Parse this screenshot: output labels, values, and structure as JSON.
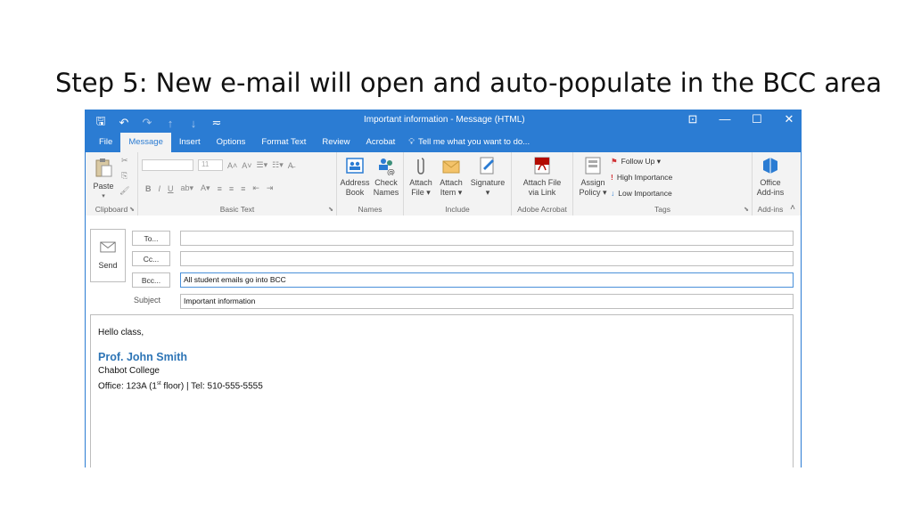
{
  "slide": {
    "title": "Step 5: New e-mail will open and auto-populate in the BCC area"
  },
  "window": {
    "title": "Important information - Message (HTML)",
    "qat": [
      "save-icon",
      "undo-icon",
      "redo-icon",
      "up-icon",
      "down-icon",
      "customize-icon"
    ],
    "controls": [
      "ribbon-display-icon",
      "minimize-icon",
      "maximize-icon",
      "close-icon"
    ]
  },
  "tabs": [
    "File",
    "Message",
    "Insert",
    "Options",
    "Format Text",
    "Review",
    "Acrobat"
  ],
  "tell_me": "Tell me what you want to do...",
  "ribbon": {
    "clipboard": {
      "paste": "Paste",
      "label": "Clipboard"
    },
    "basic_text": {
      "font_size": "11",
      "label": "Basic Text"
    },
    "names": {
      "address_book_1": "Address",
      "address_book_2": "Book",
      "check_names_1": "Check",
      "check_names_2": "Names",
      "label": "Names"
    },
    "include": {
      "attach_file_1": "Attach",
      "attach_file_2": "File ▾",
      "attach_item_1": "Attach",
      "attach_item_2": "Item ▾",
      "signature": "Signature",
      "signature_2": "▾",
      "label": "Include"
    },
    "acrobat": {
      "btn_1": "Attach File",
      "btn_2": "via Link",
      "label": "Adobe Acrobat"
    },
    "tags": {
      "assign_1": "Assign",
      "assign_2": "Policy ▾",
      "follow_up": "Follow Up ▾",
      "high": "High Importance",
      "low": "Low Importance",
      "label": "Tags"
    },
    "addins": {
      "btn_1": "Office",
      "btn_2": "Add-ins",
      "label": "Add-ins"
    }
  },
  "compose": {
    "send": "Send",
    "to_label": "To...",
    "cc_label": "Cc...",
    "bcc_label": "Bcc...",
    "subject_label": "Subject",
    "to_value": "",
    "cc_value": "",
    "bcc_value": "All student emails go into BCC",
    "subject_value": "Important information"
  },
  "body": {
    "greeting": "Hello class,",
    "sig_name": "Prof. John Smith",
    "sig_org": "Chabot College",
    "sig_office_pre": "Office: 123A (1",
    "sig_office_sup": "st",
    "sig_office_post": " floor) | Tel: 510-555-5555"
  },
  "colors": {
    "accent": "#2b7cd3",
    "signature": "#2e75b6"
  }
}
